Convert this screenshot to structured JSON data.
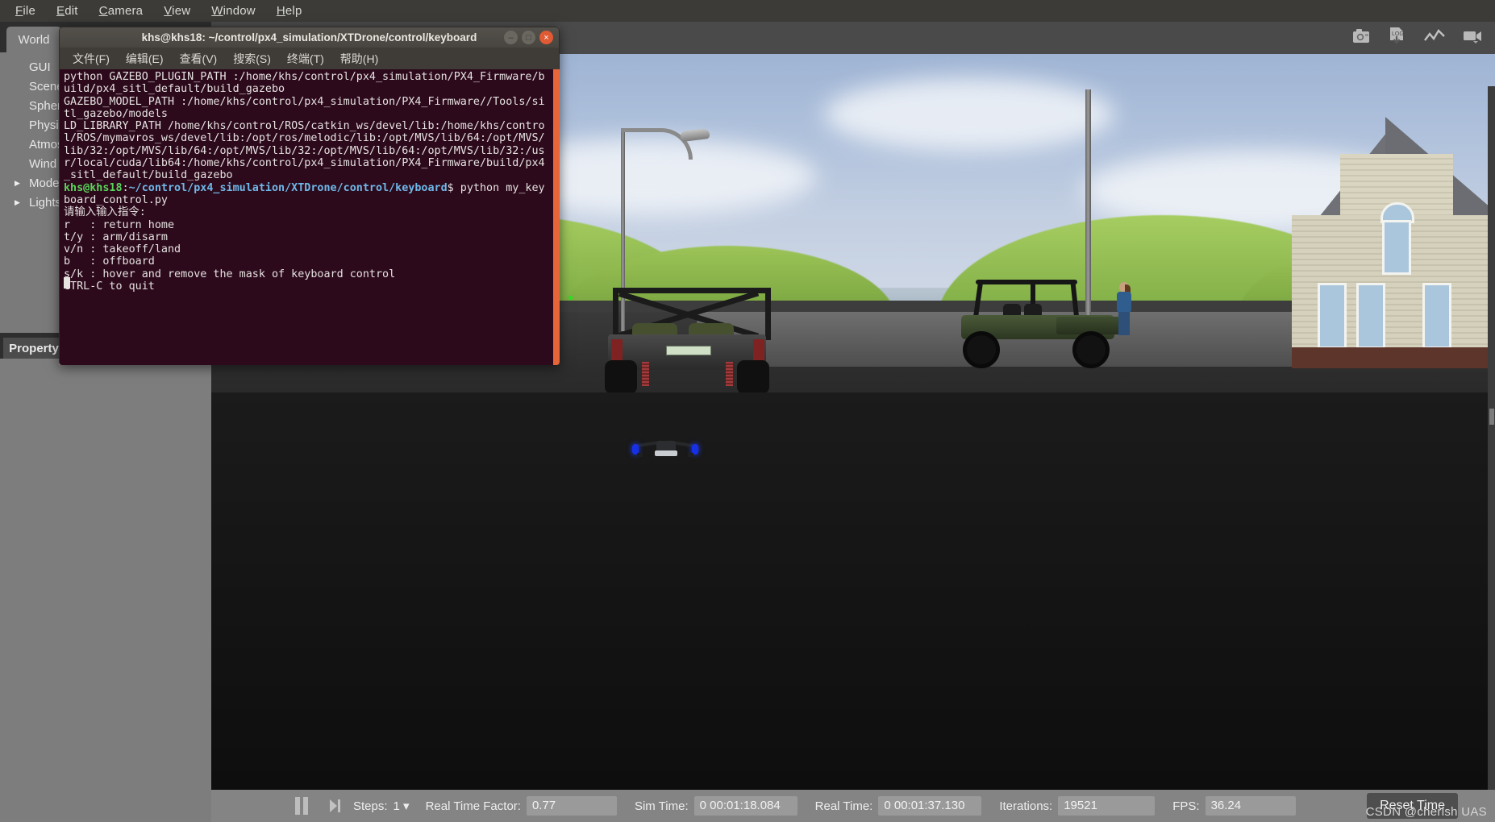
{
  "menubar": {
    "items": [
      {
        "label": "File",
        "mnemonic": "F"
      },
      {
        "label": "Edit",
        "mnemonic": "E"
      },
      {
        "label": "Camera",
        "mnemonic": "C"
      },
      {
        "label": "View",
        "mnemonic": "V"
      },
      {
        "label": "Window",
        "mnemonic": "W"
      },
      {
        "label": "Help",
        "mnemonic": "H"
      }
    ]
  },
  "left_panel": {
    "world_tab": "World",
    "property_tab": "Property",
    "tree_items": [
      {
        "label": "GUI",
        "expandable": false
      },
      {
        "label": "Scene",
        "expandable": false
      },
      {
        "label": "Spherical Coordinates",
        "expandable": false
      },
      {
        "label": "Physics",
        "expandable": false
      },
      {
        "label": "Atmosphere",
        "expandable": false
      },
      {
        "label": "Wind",
        "expandable": false
      },
      {
        "label": "Models",
        "expandable": true
      },
      {
        "label": "Lights",
        "expandable": true
      }
    ]
  },
  "scene_toolbar": {
    "right_icons": [
      {
        "name": "screenshot-icon",
        "label": "Screenshot"
      },
      {
        "name": "log-record-icon",
        "label": "LOG"
      },
      {
        "name": "plot-icon",
        "label": "Plot"
      },
      {
        "name": "video-record-icon",
        "label": "Video"
      }
    ]
  },
  "time_panel": {
    "pause_label": "Pause",
    "step_label": "Step",
    "steps_label": "Steps:",
    "steps_value": "1",
    "real_time_factor_label": "Real Time Factor:",
    "real_time_factor_value": "0.77",
    "sim_time_label": "Sim Time:",
    "sim_time_value": "0 00:01:18.084",
    "real_time_label": "Real Time:",
    "real_time_value": "0 00:01:37.130",
    "iterations_label": "Iterations:",
    "iterations_value": "19521",
    "fps_label": "FPS:",
    "fps_value": "36.24",
    "reset_button": "Reset Time"
  },
  "watermark": "CSDN @cherish UAS",
  "terminal": {
    "title": "khs@khs18: ~/control/px4_simulation/XTDrone/control/keyboard",
    "window_buttons": {
      "minimize": "–",
      "maximize": "□",
      "close": "×"
    },
    "menu": [
      "文件(F)",
      "编辑(E)",
      "查看(V)",
      "搜索(S)",
      "终端(T)",
      "帮助(H)"
    ],
    "output_before_prompt": "python GAZEBO_PLUGIN_PATH :/home/khs/control/px4_simulation/PX4_Firmware/build/px4_sitl_default/build_gazebo\nGAZEBO_MODEL_PATH :/home/khs/control/px4_simulation/PX4_Firmware//Tools/sitl_gazebo/models\nLD_LIBRARY_PATH /home/khs/control/ROS/catkin_ws/devel/lib:/home/khs/control/ROS/mymavros_ws/devel/lib:/opt/ros/melodic/lib:/opt/MVS/lib/64:/opt/MVS/lib/32:/opt/MVS/lib/64:/opt/MVS/lib/32:/opt/MVS/lib/64:/opt/MVS/lib/32:/usr/local/cuda/lib64:/home/khs/control/px4_simulation/PX4_Firmware/build/px4_sitl_default/build_gazebo\n",
    "prompt_user": "khs@khs18",
    "prompt_sep": ":",
    "prompt_path": "~/control/px4_simulation/XTDrone/control/keyboard",
    "prompt_dollar": "$ ",
    "command": "python my_keyboard_control.py",
    "output_after_prompt": "\n请输入输入指令:\nr   : return home\nt/y : arm/disarm\nv/n : takeoff/land\nb   : offboard\ns/k : hover and remove the mask of keyboard control\nCTRL-C to quit\n"
  },
  "colors": {
    "terminal_bg": "#2c0a1c",
    "terminal_scrollbar": "#e6663a",
    "prompt_user": "#59d65a",
    "prompt_path": "#6fb8e8",
    "panel_bg": "#7a7a7a",
    "time_panel_bg": "#848484",
    "menubar_bg": "#3c3b37",
    "close_button": "#e05a34"
  }
}
